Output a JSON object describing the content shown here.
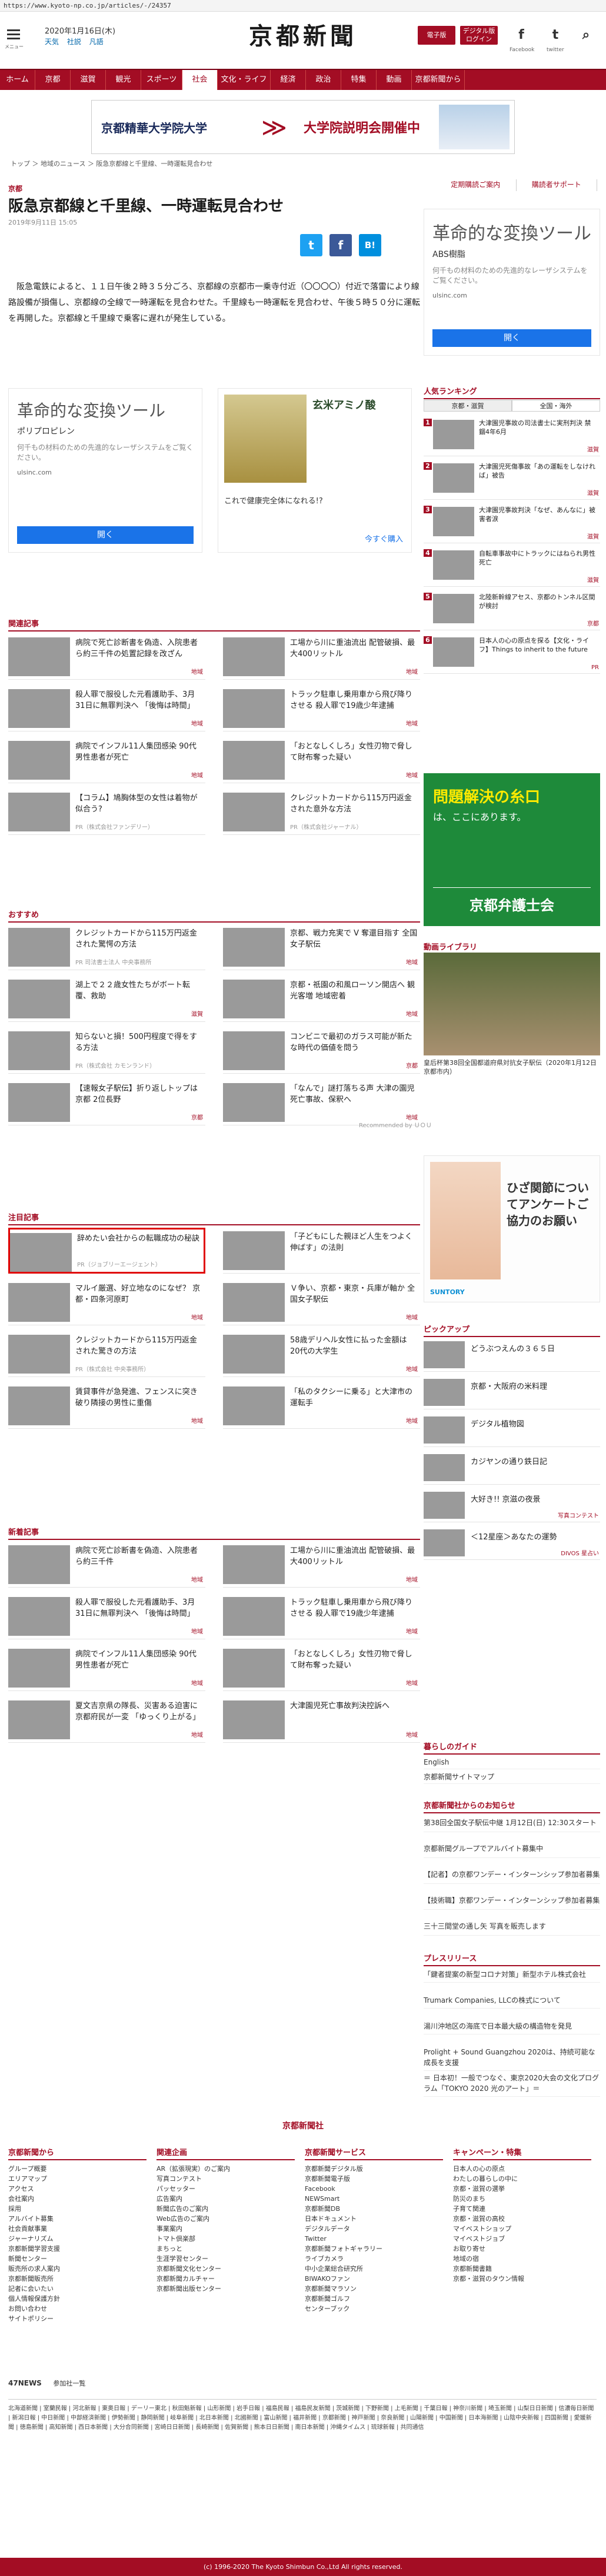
{
  "url": "https://www.kyoto-np.co.jp/articles/-/24357",
  "header": {
    "date": "2020年1月16日(木)",
    "weather": [
      "天気",
      "社説",
      "凡語"
    ],
    "logo": "京都新聞",
    "btn_ebook": "電子版",
    "btn_e_edition": "デジタル版\nログイン",
    "menu_label": "メニュー",
    "social": {
      "facebook": "f",
      "twitter": "t",
      "search": "⌕"
    },
    "social_labels": {
      "facebook": "Facebook",
      "twitter": "twitter"
    }
  },
  "nav": [
    "ホーム",
    "京都",
    "滋賀",
    "観光",
    "スポーツ",
    "社会",
    "文化・ライフ",
    "経済",
    "政治",
    "特集",
    "動画",
    "京都新聞から"
  ],
  "nav_active": "社会",
  "banner": {
    "school": "京都精華大学院大学",
    "event": "大学院説明会開催中"
  },
  "breadcrumb": "トップ ＞ 地域のニュース ＞ 阪急京都線と千里線、一時運転見合わせ",
  "right_links": [
    "定期購読ご案内",
    "購読者サポート"
  ],
  "article": {
    "section": "京都",
    "title": "阪急京都線と千里線、一時運転見合わせ",
    "date": "2019年9月11日 15:05",
    "share": {
      "twitter": "t",
      "facebook": "f",
      "hatena": "B!"
    },
    "body": "阪急電鉄によると、１１日午後２時３５分ごろ、京都線の京都市一乗寺付近（〇〇〇〇）付近で落雷により線路設備が損傷し、京都線の全線で一時運転を見合わせた。千里線も一時運転を見合わせ、午後５時５０分に運転を再開した。京都線と千里線で乗客に遅れが発生している。"
  },
  "ads": {
    "side": {
      "title": "革命的な変換ツール",
      "sub": "ABS樹脂",
      "desc": "何千もの材料のための先進的なレーザシステムをご覧ください。",
      "url": "ulsinc.com",
      "button": "開く"
    },
    "mid_left": {
      "title": "革命的な変換ツール",
      "sub": "ポリプロピレン",
      "desc": "何千もの材料のための先進的なレーザシステムをご覧ください。",
      "url": "ulsinc.com",
      "button": "開く"
    },
    "mid_right": {
      "title": "玄米アミノ酸",
      "desc": "これで健康完全体になれる!?",
      "cta": "今すぐ購入"
    }
  },
  "related": {
    "heading": "関連記事",
    "items": [
      {
        "text": "病院で死亡診断書を偽造、入院患者ら約三千件の処置記録を改ざん",
        "tag": "地域"
      },
      {
        "text": "工場から川に重油流出 配管破損、最大400リットル",
        "tag": "地域"
      },
      {
        "text": "殺人罪で服役した元看護助手、3月31日に無罪判決へ 「後悔は時間」",
        "tag": "地域"
      },
      {
        "text": "トラック駐車し乗用車から飛び降りさせる 殺人罪で19歳少年逮捕",
        "tag": "地域"
      },
      {
        "text": "病院でインフル11人集団感染 90代男性患者が死亡",
        "tag": "地域"
      },
      {
        "text": "「おとなしくしろ」女性刃物で脅して財布奪った疑い",
        "tag": "地域"
      },
      {
        "text": "【コラム】鳩胸体型の女性は着物が似合う?",
        "tag": "",
        "pr": "PR（株式会社ファンデリー）"
      },
      {
        "text": "クレジットカードから115万円返金された意外な方法",
        "tag": "",
        "pr": "PR（株式会社ジャーナル）"
      }
    ]
  },
  "recommend": {
    "heading": "おすすめ",
    "items": [
      {
        "text": "クレジットカードから115万円返金された驚愕の方法",
        "tag": "",
        "pr": "PR 司法書士法人 中央事務所"
      },
      {
        "text": "京都、戦力充実で V 奪還目指す 全国女子駅伝",
        "tag": "地域"
      },
      {
        "text": "湖上で２２歳女性たちがボート転覆、救助",
        "tag": "滋賀"
      },
      {
        "text": "京都・祇園の和風ローソン開店へ 観光客増 地域密着",
        "tag": "地域"
      },
      {
        "text": "知らないと損！500円程度で得をする方法",
        "tag": "",
        "pr": "PR（株式会社 カモンランド）"
      },
      {
        "text": "コンビニで最初のガラス可能が新たな時代の価値を問う",
        "tag": "京都"
      },
      {
        "text": "【速報女子駅伝】折り返しトップは京都 2位長野",
        "tag": "京都"
      },
      {
        "text": "「なんで」謎打落ちる声 大津の園児死亡事故、保釈へ",
        "tag": "地域"
      }
    ],
    "recommended_by": "Recommended by ＵＯＵ"
  },
  "notice": {
    "heading": "注目記事",
    "items": [
      {
        "text": "辞めたい会社からの転職成功の秘訣",
        "tag": "",
        "pr": "PR（ジョブリーエージェント）",
        "highlight": true
      },
      {
        "text": "「子どもにした親ほど人生をつよく伸ばす」の法則",
        "tag": "",
        "pr": ""
      },
      {
        "text": "マルイ厳選、好立地なのになぜ？ 京都・四条河原町",
        "tag": "地域"
      },
      {
        "text": "Ｖ争い、京都・東京・兵庫が軸か 全国女子駅伝",
        "tag": "地域"
      },
      {
        "text": "クレジットカードから115万円返金された驚きの方法",
        "tag": "",
        "pr": "PR（株式会社 中央事務所）"
      },
      {
        "text": "58歳デリヘル女性に払った金額は 20代の大学生",
        "tag": "地域"
      },
      {
        "text": "賃貸事件が急発進、フェンスに突き破り隣接の男性に重傷",
        "tag": "地域"
      },
      {
        "text": "「私のタクシーに乗る」と大津市の運転手",
        "tag": "地域"
      }
    ]
  },
  "latest": {
    "heading": "新着記事",
    "items": [
      {
        "text": "病院で死亡診断書を偽造、入院患者ら約三千件",
        "tag": "地域"
      },
      {
        "text": "工場から川に重油流出 配管破損、最大400リットル",
        "tag": "地域"
      },
      {
        "text": "殺人罪で服役した元看護助手、3月31日に無罪判決へ 「後悔は時間」",
        "tag": "地域"
      },
      {
        "text": "トラック駐車し乗用車から飛び降りさせる 殺人罪で19歳少年逮捕",
        "tag": "地域"
      },
      {
        "text": "病院でインフル11人集団感染 90代男性患者が死亡",
        "tag": "地域"
      },
      {
        "text": "「おとなしくしろ」女性刃物で脅して財布奪った疑い",
        "tag": "地域"
      },
      {
        "text": "夏文吉京県の隊長、災害ある迫害に京都府民が一変 「ゆっくり上がる」",
        "tag": "地域"
      },
      {
        "text": "大津園児死亡事故判決控訴へ",
        "tag": "地域"
      }
    ]
  },
  "ranking": {
    "heading": "人気ランキング",
    "tabs": [
      "京都・滋賀",
      "全国・海外"
    ],
    "items": [
      {
        "rank": "1",
        "text": "大津園児事故の司法書士に実刑判決 禁錮4年6月",
        "tag": "滋賀"
      },
      {
        "rank": "2",
        "text": "大津園児死傷事故「あの運転をしなければ」被告",
        "tag": "滋賀"
      },
      {
        "rank": "3",
        "text": "大津園児事故判決「なぜ、あんなに」被害者涙",
        "tag": "滋賀"
      },
      {
        "rank": "4",
        "text": "自転車事故中にトラックにはねられ男性死亡",
        "tag": "滋賀"
      },
      {
        "rank": "5",
        "text": "北陸新幹線アセス、京都のトンネル区間が検討",
        "tag": "京都"
      },
      {
        "rank": "6",
        "text": "日本人の心の原点を探る【文化・ライフ】Things to inherit to the future",
        "tag": "PR"
      }
    ]
  },
  "green_ad": {
    "line1": "問題解決の糸口",
    "line2": "は、ここにあります。",
    "org": "京都弁護士会"
  },
  "video_library": {
    "heading": "動画ライブラリ",
    "caption": "皇后杯第38回全国都道府県対抗女子駅伝（2020年1月12日 京都市内）"
  },
  "knee_ad": {
    "title": "ひざ関節についてアンケートご協力のお願い",
    "brand": "SUNTORY"
  },
  "pickup": {
    "heading": "ピックアップ",
    "items": [
      {
        "text": "どうぶつえんの３６５日",
        "tag": ""
      },
      {
        "text": "京都・大阪府の米料理",
        "tag": ""
      },
      {
        "text": "デジタル植物図",
        "tag": ""
      },
      {
        "text": "カジヤンの通り鉄日記",
        "tag": ""
      },
      {
        "text": "大好き!! 京滋の夜景",
        "tag": "写真コンテスト"
      },
      {
        "text": "＜12星座＞あなたの運勢",
        "tag": "DIVOS 星占い"
      }
    ]
  },
  "guide": {
    "heading": "暮らしのガイド",
    "items": [
      "English",
      "京都新聞サイトマップ"
    ]
  },
  "kn_notice": {
    "heading": "京都新聞社からのお知らせ",
    "items": [
      "第38回全国女子駅伝中継 1月12日(日) 12:30スタート",
      "京都新聞グループでアルバイト募集中",
      "【記者】の京都ワンデー・インターンシップ参加者募集",
      "【技術職】京都ワンデー・インターンシップ参加者募集",
      "三十三間堂の通し矢 写真を販売します"
    ]
  },
  "press": {
    "heading": "プレスリリース",
    "items": [
      "「鍵者提案の新型コロナ対策」新型ホテル株式会社",
      "Trumark Companies, LLCの株式について",
      "湯川沖地区の海底で日本最大級の構造物を発見",
      "Prolight + Sound Guangzhou 2020は、持続可能な成長を支援",
      "＝ 日本初！一般でつなぐ、東京2020大会の文化プログラム「TOKYO 2020 光のアート」＝"
    ]
  },
  "footer": {
    "brand": "京都新聞社",
    "columns": [
      {
        "head": "京都新聞から",
        "items": [
          "グループ概要",
          "エリアマップ",
          "アクセス",
          "会社案内",
          "採用",
          "アルバイト募集",
          "社会貢献事業",
          "ジャーナリズム",
          "京都新聞学習支援",
          "新聞センター",
          "販売所の求人案内",
          "京都新聞販売所",
          "記者に会いたい",
          "個人情報保護方針",
          "お問い合わせ",
          "サイトポリシー"
        ]
      },
      {
        "head": "関連企画",
        "items": [
          "AR（拡張現実）のご案内",
          "写真コンテスト",
          "パッセッター",
          "広告案内",
          "新聞広告のご案内",
          "Web広告のご案内",
          "事業案内",
          "トマト倶楽部",
          "まちっと",
          "生涯学習センター",
          "京都新聞文化センター",
          "京都新聞カルチャー",
          "京都新聞出版センター"
        ]
      },
      {
        "head": "京都新聞サービス",
        "items": [
          "京都新聞デジタル版",
          "京都新聞電子版",
          "Facebook",
          "NEWSmart",
          "京都新聞DB",
          "日本ドキュメント",
          "デジタルデータ",
          "Twitter",
          "京都新聞フォトギャラリー",
          "ライブカメラ",
          "中小企業総合研究所",
          "BIWAKOファン",
          "京都新聞マラソン",
          "京都新聞ゴルフ",
          "センターブック"
        ]
      },
      {
        "head": "キャンペーン・特集",
        "items": [
          "日本人の心の原点",
          "わたしの暮らしの中に",
          "京都・滋賀の選挙",
          "防災のまち",
          "子育て関連",
          "京都・滋賀の高校",
          "マイベストショップ",
          "マイベストジョブ",
          "お取り寄せ",
          "地域の宿",
          "京都新聞書籍",
          "京都・滋賀のタウン情報"
        ]
      }
    ]
  },
  "news47": {
    "label": "47NEWS",
    "sub": "参加社一覧"
  },
  "partners": "北海道新聞 | 室蘭民報 | 河北新報 | 東奥日報 | デーリー東北 | 秋田魁新報 | 山形新聞 | 岩手日報 | 福島民報 | 福島民友新聞 | 茨城新聞 | 下野新聞 | 上毛新聞 | 千葉日報 | 神奈川新聞 | 埼玉新聞 | 山梨日日新聞 | 信濃毎日新聞 | 新潟日報 | 中日新聞 | 中部経済新聞 | 伊勢新聞 | 静岡新聞 | 岐阜新聞 | 北日本新聞 | 北國新聞 | 富山新聞 | 福井新聞 | 京都新聞 | 神戸新聞 | 奈良新聞 | 山陽新聞 | 中国新聞 | 日本海新聞 | 山陰中央新報 | 四国新聞 | 愛媛新聞 | 徳島新聞 | 高知新聞 | 西日本新聞 | 大分合同新聞 | 宮崎日日新聞 | 長崎新聞 | 佐賀新聞 | 熊本日日新聞 | 南日本新聞 | 沖縄タイムス | 琉球新報 | 共同通信",
  "copyright": "(c) 1996-2020 The Kyoto Shimbun Co.,Ltd All rights reserved."
}
